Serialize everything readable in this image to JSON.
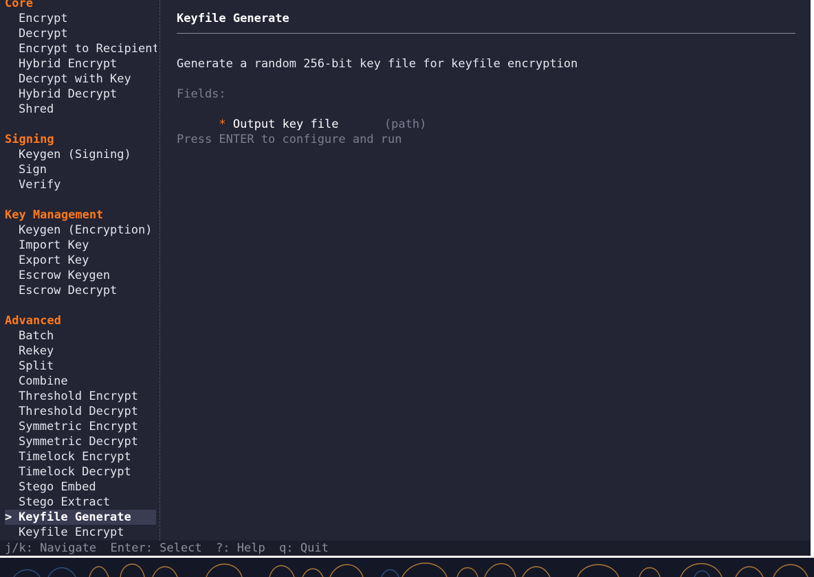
{
  "sidebar": {
    "lines": [
      {
        "type": "header",
        "text": "Core"
      },
      {
        "type": "item",
        "text": "Encrypt"
      },
      {
        "type": "item",
        "text": "Decrypt"
      },
      {
        "type": "item",
        "text": "Encrypt to Recipient"
      },
      {
        "type": "item",
        "text": "Hybrid Encrypt"
      },
      {
        "type": "item",
        "text": "Decrypt with Key"
      },
      {
        "type": "item",
        "text": "Hybrid Decrypt"
      },
      {
        "type": "item",
        "text": "Shred"
      },
      {
        "type": "blank",
        "text": ""
      },
      {
        "type": "header",
        "text": "Signing"
      },
      {
        "type": "item",
        "text": "Keygen (Signing)"
      },
      {
        "type": "item",
        "text": "Sign"
      },
      {
        "type": "item",
        "text": "Verify"
      },
      {
        "type": "blank",
        "text": ""
      },
      {
        "type": "header",
        "text": "Key Management"
      },
      {
        "type": "item",
        "text": "Keygen (Encryption)"
      },
      {
        "type": "item",
        "text": "Import Key"
      },
      {
        "type": "item",
        "text": "Export Key"
      },
      {
        "type": "item",
        "text": "Escrow Keygen"
      },
      {
        "type": "item",
        "text": "Escrow Decrypt"
      },
      {
        "type": "blank",
        "text": ""
      },
      {
        "type": "header",
        "text": "Advanced"
      },
      {
        "type": "item",
        "text": "Batch"
      },
      {
        "type": "item",
        "text": "Rekey"
      },
      {
        "type": "item",
        "text": "Split"
      },
      {
        "type": "item",
        "text": "Combine"
      },
      {
        "type": "item",
        "text": "Threshold Encrypt"
      },
      {
        "type": "item",
        "text": "Threshold Decrypt"
      },
      {
        "type": "item",
        "text": "Symmetric Encrypt"
      },
      {
        "type": "item",
        "text": "Symmetric Decrypt"
      },
      {
        "type": "item",
        "text": "Timelock Encrypt"
      },
      {
        "type": "item",
        "text": "Timelock Decrypt"
      },
      {
        "type": "item",
        "text": "Stego Embed"
      },
      {
        "type": "item",
        "text": "Stego Extract"
      },
      {
        "type": "selected",
        "text": "Keyfile Generate",
        "caret": ">"
      },
      {
        "type": "item",
        "text": "Keyfile Encrypt"
      }
    ]
  },
  "detail": {
    "title": "Keyfile Generate",
    "description": "Generate a random 256-bit key file for keyfile encryption",
    "fields_label": "Fields:",
    "fields": [
      {
        "required_marker": "*",
        "name": "Output key file",
        "type": "(path)"
      }
    ],
    "hint": "Press ENTER to configure and run"
  },
  "statusbar": {
    "text": "j/k: Navigate  Enter: Select  ?: Help  q: Quit"
  },
  "colors": {
    "background": "#232434",
    "accent": "#ff7a1a",
    "text": "#e4e6ee",
    "dim": "#7d7f90",
    "selection": "#3a3c52"
  }
}
